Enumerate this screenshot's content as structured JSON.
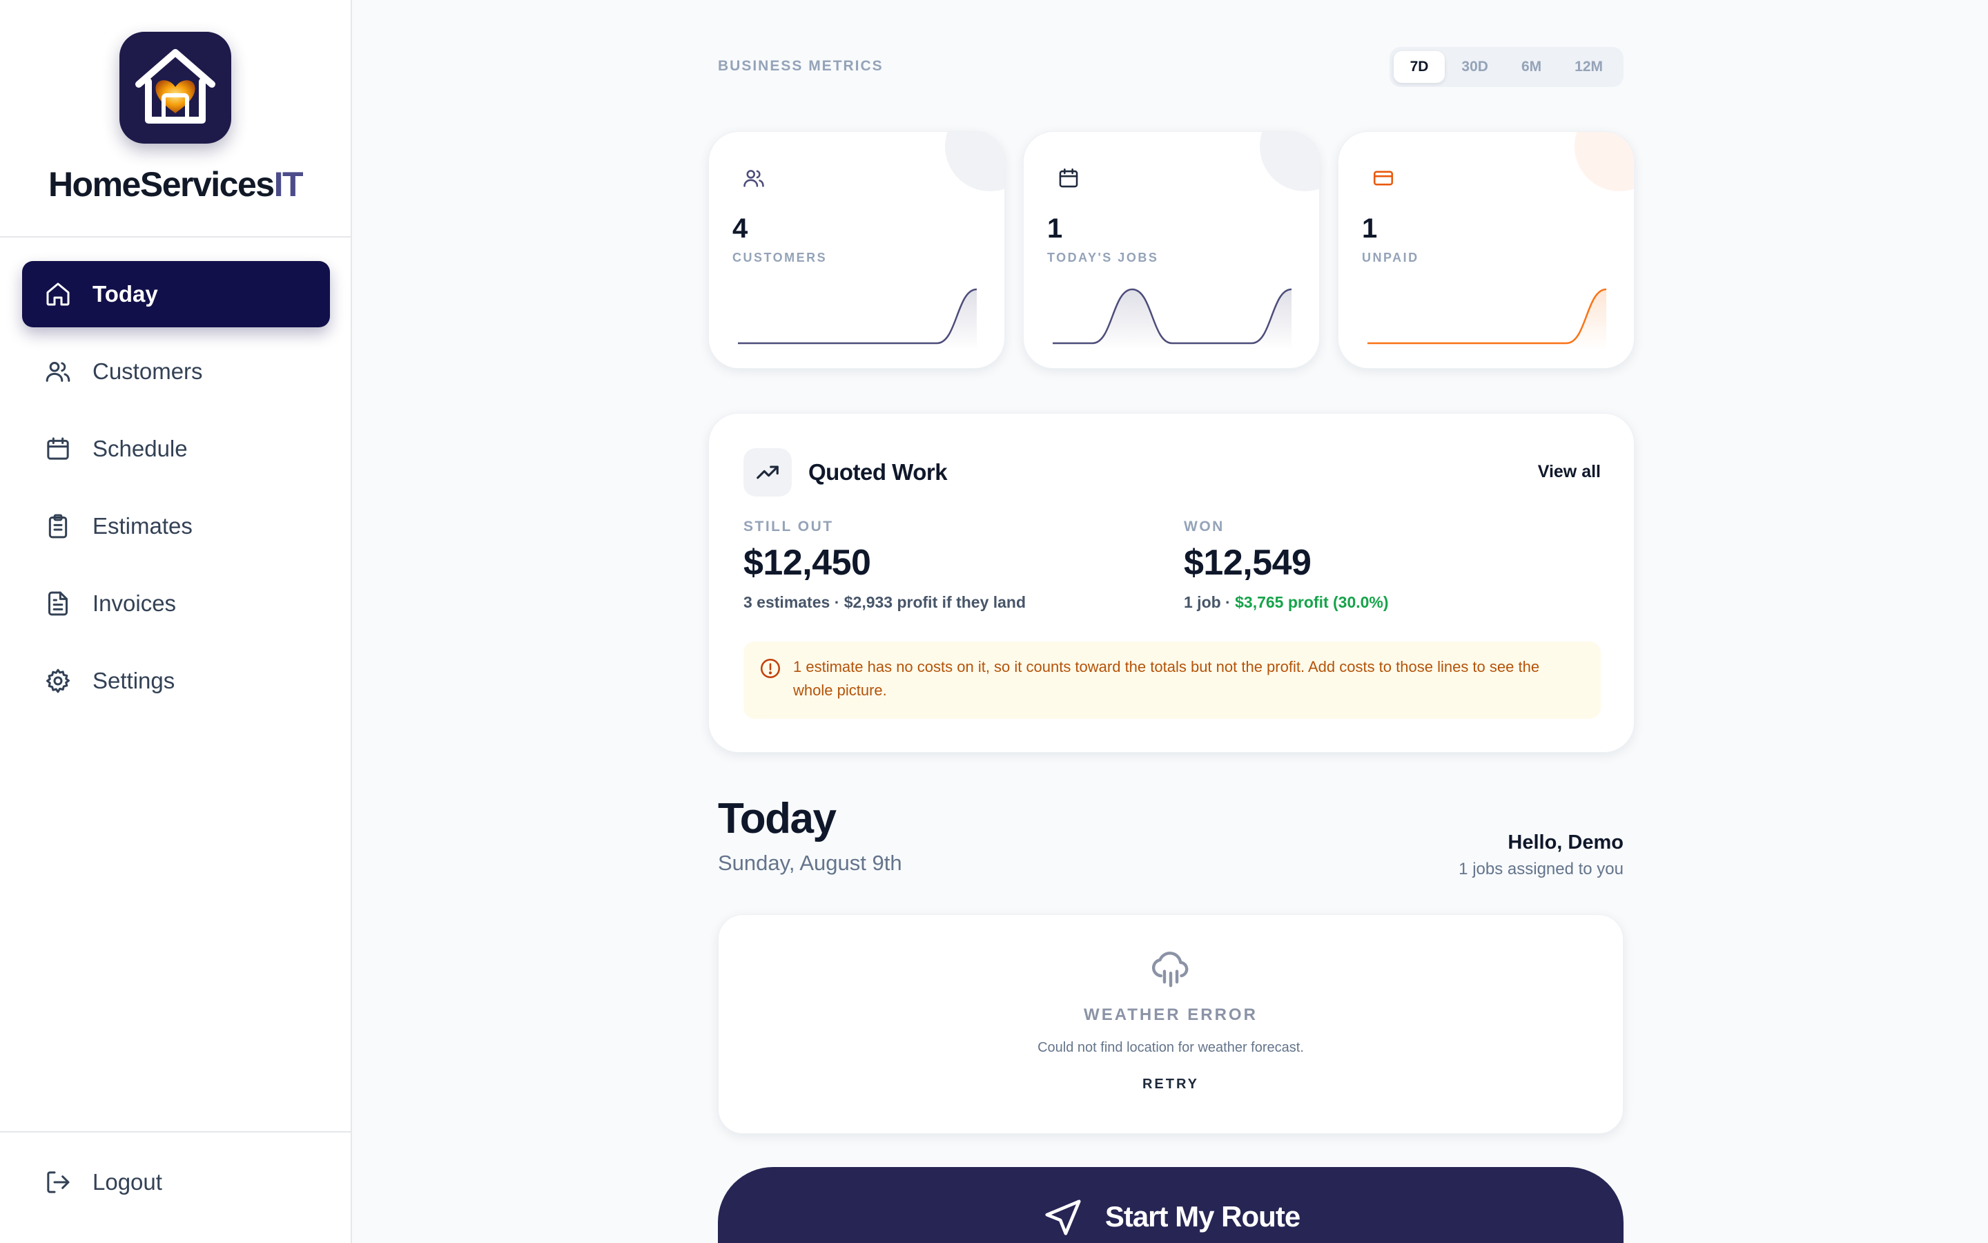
{
  "app": {
    "brand_main": "HomeServices",
    "brand_accent": "IT"
  },
  "sidebar": {
    "items": [
      {
        "label": "Today",
        "icon": "home-icon",
        "active": true
      },
      {
        "label": "Customers",
        "icon": "users-icon"
      },
      {
        "label": "Schedule",
        "icon": "calendar-icon"
      },
      {
        "label": "Estimates",
        "icon": "clipboard-icon"
      },
      {
        "label": "Invoices",
        "icon": "file-text-icon"
      },
      {
        "label": "Settings",
        "icon": "gear-icon"
      }
    ],
    "logout_label": "Logout"
  },
  "metrics": {
    "section_label": "BUSINESS METRICS",
    "ranges": [
      "7D",
      "30D",
      "6M",
      "12M"
    ],
    "active_range": "7D",
    "cards": [
      {
        "value": "4",
        "label": "CUSTOMERS",
        "icon": "users-icon",
        "color": "#4c4c7a",
        "trend": [
          0,
          0,
          0,
          0,
          0,
          0,
          4
        ]
      },
      {
        "value": "1",
        "label": "TODAY'S JOBS",
        "icon": "calendar-icon",
        "color": "#4c4c7a",
        "trend": [
          0,
          0,
          1,
          0,
          0,
          0,
          1
        ]
      },
      {
        "value": "1",
        "label": "UNPAID",
        "icon": "credit-card-icon",
        "color": "#f97316",
        "trend": [
          0,
          0,
          0,
          0,
          0,
          0,
          1
        ]
      }
    ]
  },
  "quoted_work": {
    "title": "Quoted Work",
    "view_all": "View all",
    "still_out": {
      "label": "STILL OUT",
      "amount": "$12,450",
      "detail": "3 estimates · $2,933 profit if they land"
    },
    "won": {
      "label": "WON",
      "amount": "$12,549",
      "detail_prefix": "1 job · ",
      "detail_profit": "$3,765 profit (30.0%)"
    },
    "warning": "1 estimate has no costs on it, so it counts toward the totals but not the profit. Add costs to those lines to see the whole picture."
  },
  "today": {
    "title": "Today",
    "date": "Sunday, August 9th",
    "hello": "Hello, Demo",
    "assigned": "1 jobs assigned to you"
  },
  "weather": {
    "title": "WEATHER ERROR",
    "message": "Could not find location for weather forecast.",
    "retry": "RETRY"
  },
  "route_button": "Start My Route",
  "colors": {
    "primary": "#12104a",
    "route_button": "#262554",
    "success": "#16a34a",
    "warning_text": "#b45309",
    "warning_bg": "#fffbeb",
    "unpaid_accent": "#f97316"
  }
}
